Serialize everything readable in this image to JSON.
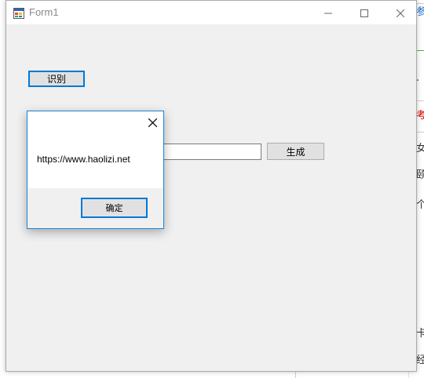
{
  "background_app": {
    "chars": [
      "参",
      "·",
      "考",
      "女",
      "颐",
      "个",
      "卡",
      "经"
    ]
  },
  "window": {
    "title": "Form1",
    "icon": "winforms-app-icon",
    "controls": {
      "minimize_icon": "minimize-icon",
      "maximize_icon": "maximize-icon",
      "close_icon": "close-icon"
    }
  },
  "form": {
    "recognize_button_label": "识别",
    "input_value": "",
    "generate_button_label": "生成"
  },
  "message_box": {
    "text": "https://www.haolizi.net",
    "ok_button_label": "确定",
    "close_icon": "close-icon"
  },
  "colors": {
    "accent": "#0078d7",
    "window_bg": "#f0f0f0",
    "button_bg": "#e1e1e1"
  }
}
